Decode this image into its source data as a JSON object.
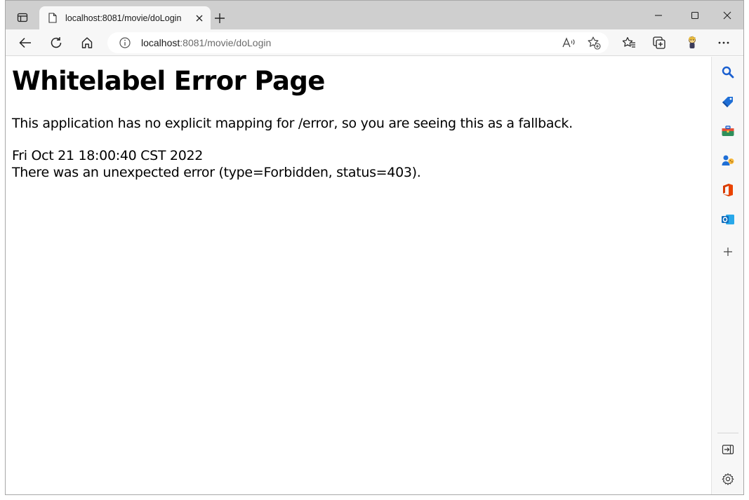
{
  "browser": {
    "tab": {
      "title": "localhost:8081/movie/doLogin"
    },
    "address_bar": {
      "host": "localhost",
      "rest": ":8081/movie/doLogin"
    }
  },
  "page": {
    "heading": "Whitelabel Error Page",
    "description": "This application has no explicit mapping for /error, so you are seeing this as a fallback.",
    "timestamp": "Fri Oct 21 18:00:40 CST 2022",
    "error_message": "There was an unexpected error (type=Forbidden, status=403)."
  },
  "colors": {
    "tabbar_bg": "#cfcfcf",
    "toolbar_bg": "#f7f7f7",
    "search_blue": "#1a5fd0",
    "office_red": "#d83b01",
    "outlook_blue": "#0f6cbd"
  }
}
